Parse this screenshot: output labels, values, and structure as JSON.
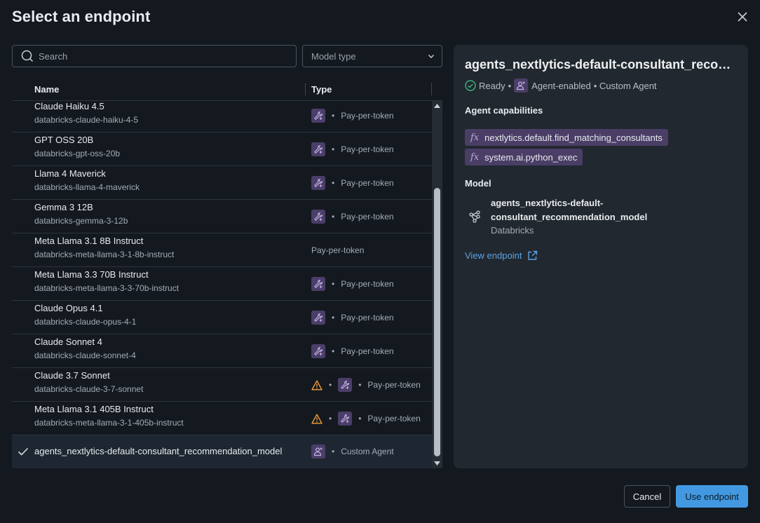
{
  "dialog": {
    "title": "Select an endpoint"
  },
  "search": {
    "placeholder": "Search"
  },
  "filter": {
    "placeholder": "Model type"
  },
  "table": {
    "headers": {
      "name": "Name",
      "type": "Type"
    },
    "rows": [
      {
        "name": "Claude Haiku 4.5",
        "id": "databricks-claude-haiku-4-5",
        "type": "Pay-per-token",
        "icons": [
          "tool-agent-icon"
        ],
        "warning": false,
        "selected": false
      },
      {
        "name": "GPT OSS 20B",
        "id": "databricks-gpt-oss-20b",
        "type": "Pay-per-token",
        "icons": [
          "tool-agent-icon"
        ],
        "warning": false,
        "selected": false
      },
      {
        "name": "Llama 4 Maverick",
        "id": "databricks-llama-4-maverick",
        "type": "Pay-per-token",
        "icons": [
          "tool-agent-icon"
        ],
        "warning": false,
        "selected": false
      },
      {
        "name": "Gemma 3 12B",
        "id": "databricks-gemma-3-12b",
        "type": "Pay-per-token",
        "icons": [
          "tool-agent-icon"
        ],
        "warning": false,
        "selected": false
      },
      {
        "name": "Meta Llama 3.1 8B Instruct",
        "id": "databricks-meta-llama-3-1-8b-instruct",
        "type": "Pay-per-token",
        "icons": [],
        "warning": false,
        "selected": false
      },
      {
        "name": "Meta Llama 3.3 70B Instruct",
        "id": "databricks-meta-llama-3-3-70b-instruct",
        "type": "Pay-per-token",
        "icons": [
          "tool-agent-icon"
        ],
        "warning": false,
        "selected": false
      },
      {
        "name": "Claude Opus 4.1",
        "id": "databricks-claude-opus-4-1",
        "type": "Pay-per-token",
        "icons": [
          "tool-agent-icon"
        ],
        "warning": false,
        "selected": false
      },
      {
        "name": "Claude Sonnet 4",
        "id": "databricks-claude-sonnet-4",
        "type": "Pay-per-token",
        "icons": [
          "tool-agent-icon"
        ],
        "warning": false,
        "selected": false
      },
      {
        "name": "Claude 3.7 Sonnet",
        "id": "databricks-claude-3-7-sonnet",
        "type": "Pay-per-token",
        "icons": [
          "tool-agent-icon"
        ],
        "warning": true,
        "selected": false
      },
      {
        "name": "Meta Llama 3.1 405B Instruct",
        "id": "databricks-meta-llama-3-1-405b-instruct",
        "type": "Pay-per-token",
        "icons": [
          "tool-agent-icon"
        ],
        "warning": true,
        "selected": false
      },
      {
        "name": "agents_nextlytics-default-consultant_recommendation_model",
        "id": "",
        "type": "Custom Agent",
        "icons": [
          "user-agent-icon"
        ],
        "warning": false,
        "selected": true
      }
    ]
  },
  "detail": {
    "title": "agents_nextlytics-default-consultant_recommendation_model",
    "status": {
      "ready": "Ready",
      "sep": "•",
      "agent": "Agent-enabled",
      "kind": "• Custom Agent"
    },
    "capabilities_heading": "Agent capabilities",
    "capabilities": [
      "nextlytics.default.find_matching_consultants",
      "system.ai.python_exec"
    ],
    "model_heading": "Model",
    "model": {
      "name": "agents_nextlytics-default-consultant_recommendation_model",
      "provider": "Databricks"
    },
    "view_link": "View endpoint"
  },
  "footer": {
    "cancel": "Cancel",
    "use": "Use endpoint"
  },
  "colors": {
    "accent": "#4299e1",
    "badge": "#4b3e68",
    "warning": "#f59f3a",
    "ready": "#3fb27f",
    "link": "#5aa2e6"
  }
}
